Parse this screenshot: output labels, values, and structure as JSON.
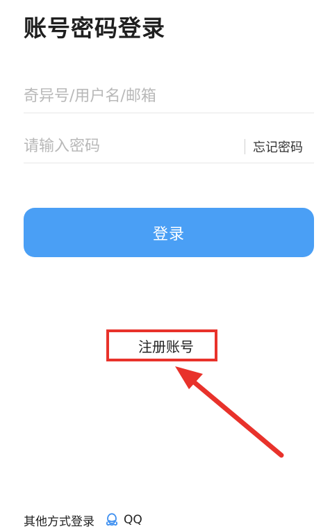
{
  "page": {
    "title": "账号密码登录"
  },
  "form": {
    "account_placeholder": "奇异号/用户名/邮箱",
    "password_placeholder": "请输入密码",
    "forgot_label": "忘记密码",
    "login_label": "登录"
  },
  "register": {
    "label": "注册账号"
  },
  "other_login": {
    "label": "其他方式登录",
    "qq_label": "QQ"
  },
  "colors": {
    "primary_button": "#4a9ff5",
    "highlight_red": "#e8322b"
  }
}
